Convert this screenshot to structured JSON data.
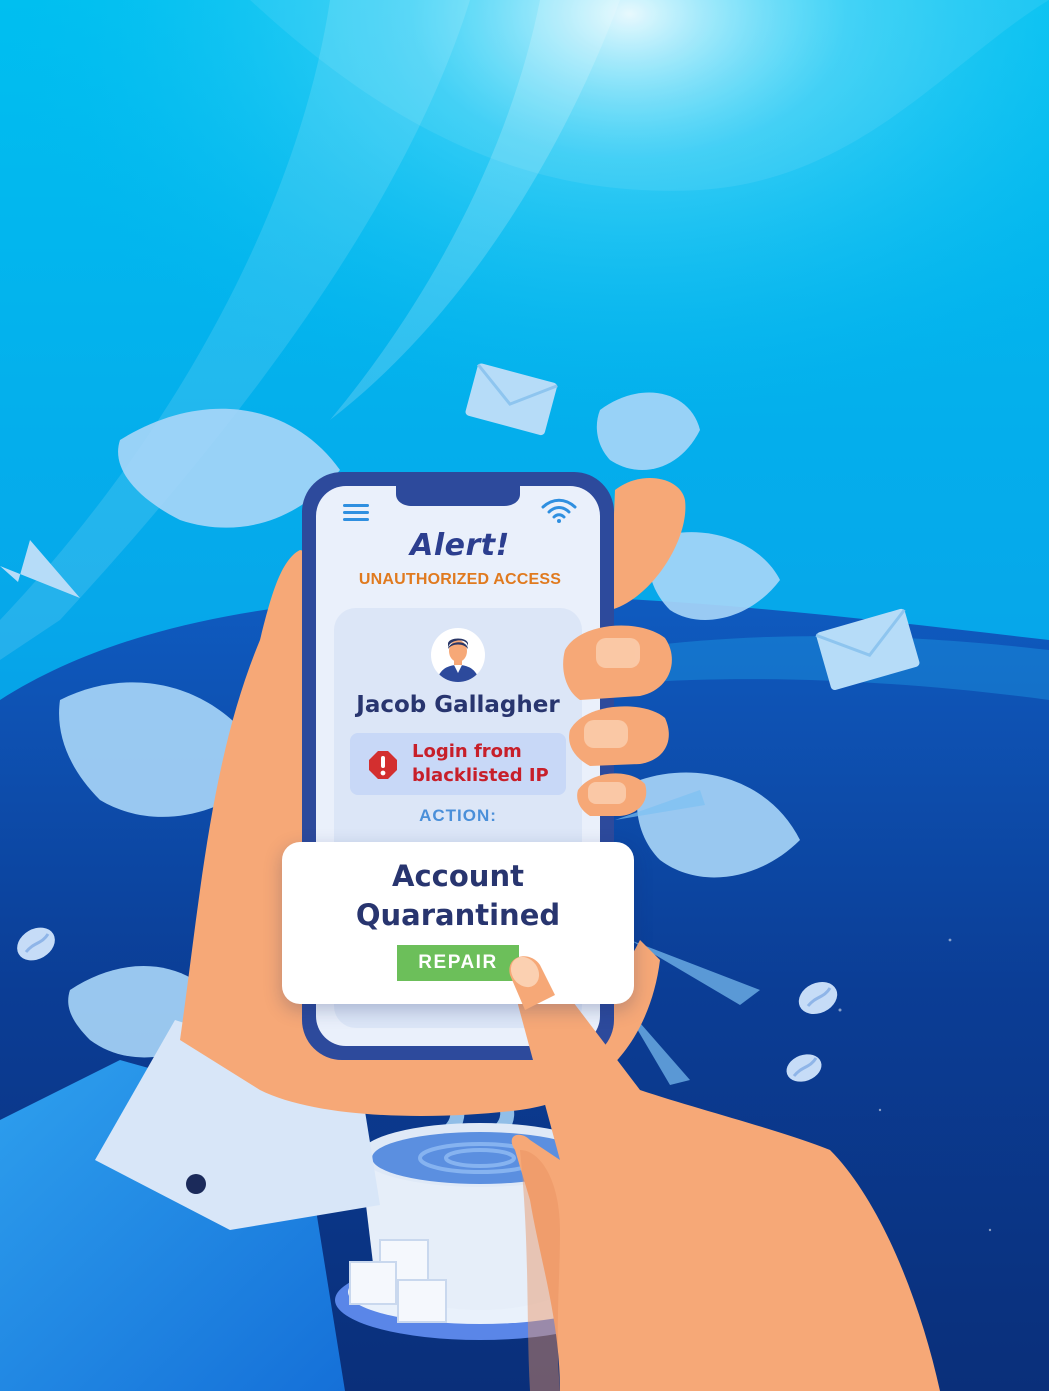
{
  "alert": {
    "title": "Alert!",
    "subtitle": "UNAUTHORIZED ACCESS"
  },
  "user": {
    "name": "Jacob Gallagher"
  },
  "warning": {
    "line1": "Login from",
    "line2": "blacklisted IP"
  },
  "action_label": "ACTION:",
  "result": {
    "line1": "Account",
    "line2": "Quarantined"
  },
  "repair_button": "REPAIR",
  "icons": {
    "menu": "hamburger-menu-icon",
    "wifi": "wifi-icon",
    "avatar": "user-avatar-icon",
    "warning": "exclamation-warning-icon"
  },
  "colors": {
    "alert_title": "#2c3e8f",
    "alert_subtitle": "#e07a1f",
    "warning_text": "#c71f2a",
    "warning_icon": "#d32f2f",
    "action_label": "#4a8fd9",
    "repair_button": "#6cbf5a"
  }
}
